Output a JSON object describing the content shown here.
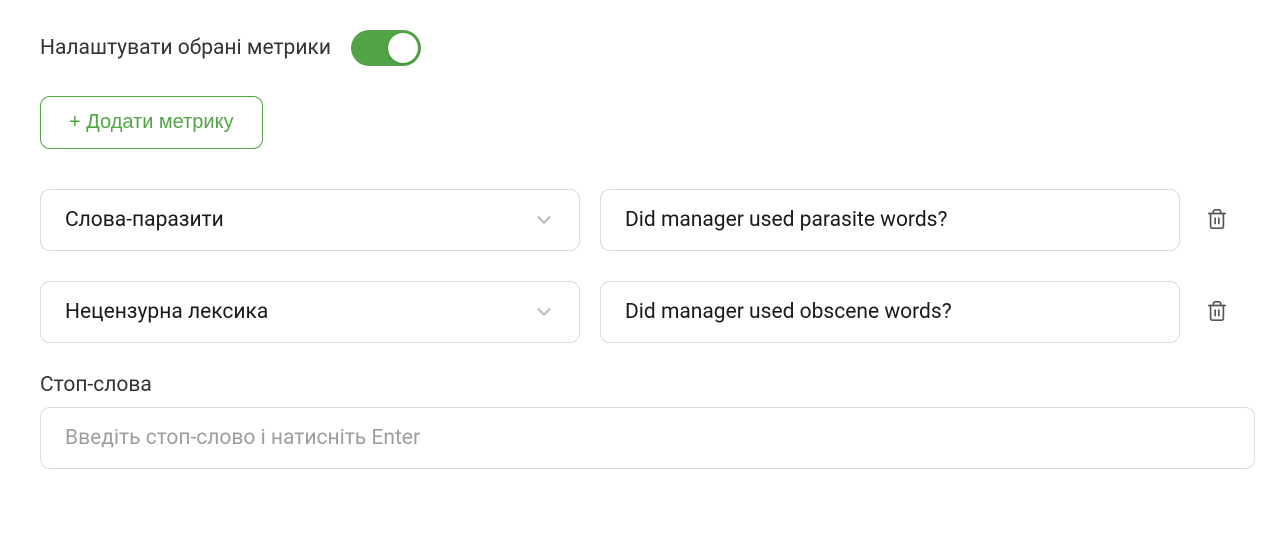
{
  "header": {
    "label": "Налаштувати обрані метрики",
    "toggle_on": true
  },
  "add_button": {
    "label": "+ Додати метрику"
  },
  "metrics": [
    {
      "select_value": "Слова-паразити",
      "question_value": "Did manager used parasite words?"
    },
    {
      "select_value": "Нецензурна лексика",
      "question_value": "Did manager used obscene words?"
    }
  ],
  "stopwords": {
    "label": "Стоп-слова",
    "placeholder": "Введіть стоп-слово і натисніть Enter"
  }
}
